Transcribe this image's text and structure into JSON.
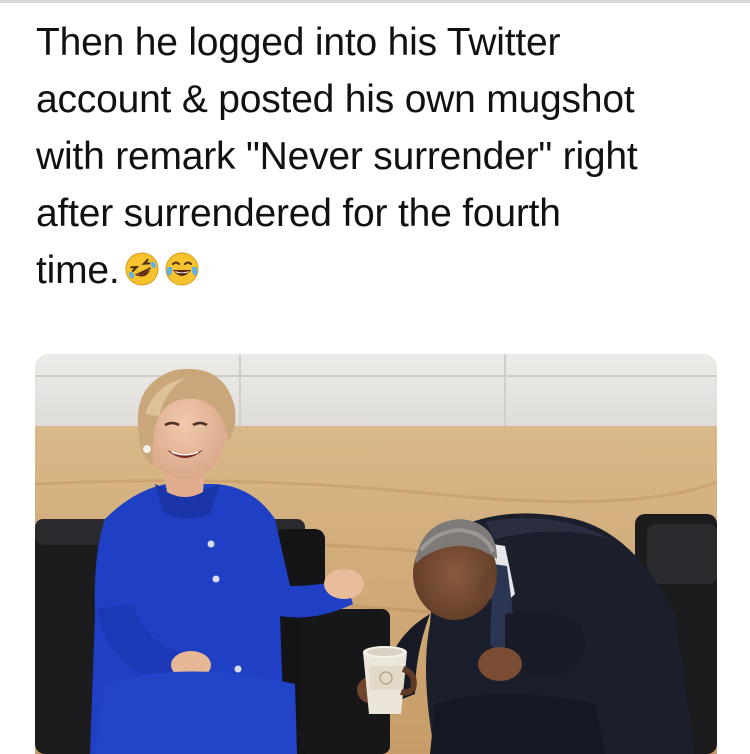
{
  "caption": {
    "lines": [
      "Then he logged into his Twitter",
      "account & posted his own mugshot",
      "with remark \"Never surrender\" right",
      "after surrendered for the fourth",
      "time."
    ],
    "emojis": [
      "rolling-on-floor-laughing-emoji",
      "tears-of-joy-emoji"
    ]
  },
  "photo": {
    "subject": "two-people-laughing-photo",
    "colors": {
      "wall_top": "#e6e3df",
      "wood_panel": "#d2ae7f",
      "blue_suit": "#1f3fc4",
      "dark_suit": "#1b1e2b",
      "chair": "#1a1a1c",
      "cup": "#ece6da"
    }
  }
}
